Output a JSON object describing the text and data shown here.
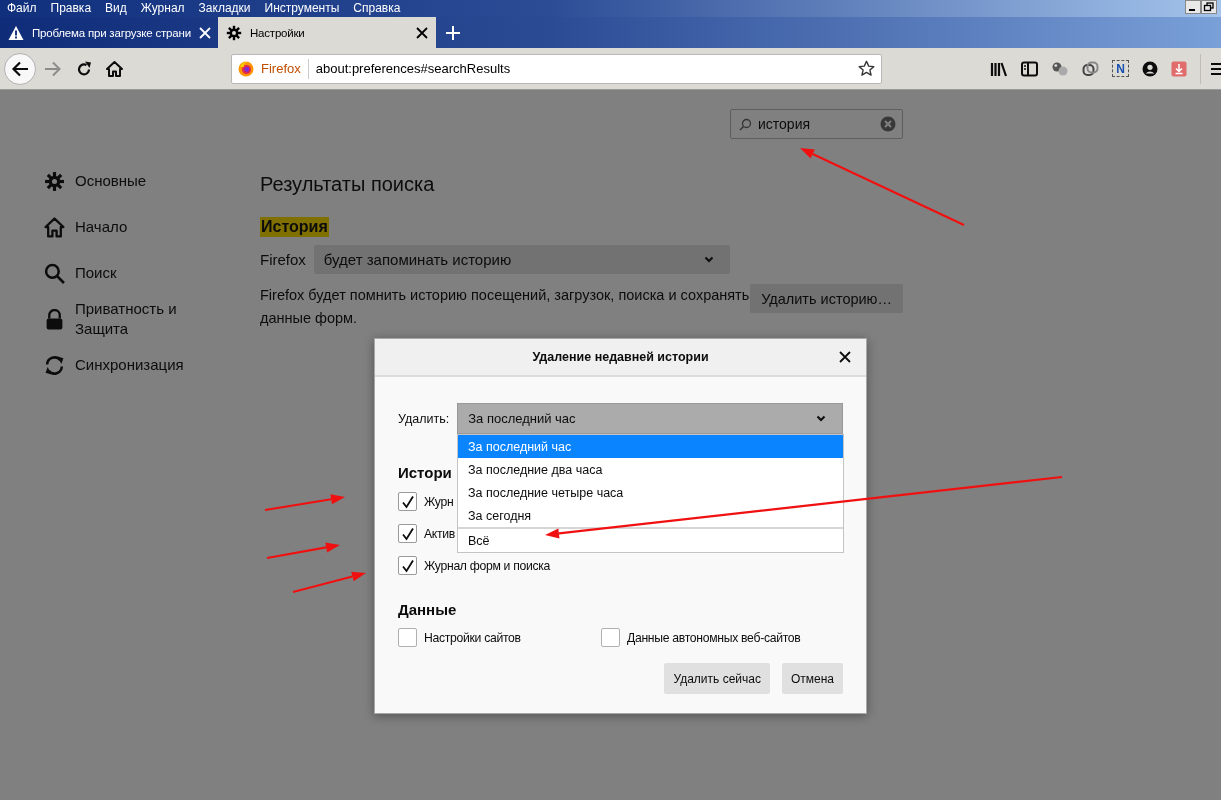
{
  "menu": [
    {
      "label": "Файл"
    },
    {
      "label": "Правка"
    },
    {
      "label": "Вид"
    },
    {
      "label": "Журнал"
    },
    {
      "label": "Закладки"
    },
    {
      "label": "Инструменты"
    },
    {
      "label": "Справка"
    }
  ],
  "tabs": [
    {
      "label": "Проблема при загрузке страни",
      "kind": "warning",
      "selected": false
    },
    {
      "label": "Настройки",
      "kind": "settings",
      "selected": true
    }
  ],
  "toolbar": {
    "buttons": [
      {
        "kind": "back",
        "disabled": false
      },
      {
        "kind": "forward",
        "disabled": true
      },
      {
        "kind": "reload",
        "disabled": false
      },
      {
        "kind": "home",
        "disabled": false
      }
    ],
    "address": {
      "identity": "Firefox",
      "url": "about:preferences#searchResults"
    },
    "extensions": [
      {
        "kind": "library"
      },
      {
        "kind": "sidebar"
      },
      {
        "kind": "spheres"
      },
      {
        "kind": "loop"
      },
      {
        "kind": "note",
        "label": "N"
      },
      {
        "kind": "account"
      },
      {
        "kind": "download"
      },
      {
        "kind": "menu"
      }
    ]
  },
  "sidebar": {
    "items": [
      {
        "label": "Основные",
        "kind": "general",
        "selected": false
      },
      {
        "label": "Начало",
        "kind": "home",
        "selected": false
      },
      {
        "label": "Поиск",
        "kind": "search",
        "selected": false
      },
      {
        "label": "Приватность и Защита",
        "kind": "privacy",
        "selected": false
      },
      {
        "label": "Синхронизация",
        "kind": "sync",
        "selected": false
      }
    ]
  },
  "search": {
    "value": "история"
  },
  "results": {
    "title": "Результаты поиска",
    "section": {
      "label": "История",
      "highlighted": true
    },
    "mode_label": "Firefox",
    "mode_value": "будет запоминать историю",
    "description": "Firefox будет помнить историю посещений, загрузок, поиска и сохранять данные форм.",
    "clear_button": "Удалить историю…"
  },
  "dialog": {
    "title": "Удаление недавней истории",
    "range_label": "Удалить:",
    "range_value": "За последний час",
    "options": [
      {
        "label": "За последний час",
        "selected": true,
        "separated": false
      },
      {
        "label": "За последние два часа",
        "selected": false,
        "separated": false
      },
      {
        "label": "За последние четыре часа",
        "selected": false,
        "separated": false
      },
      {
        "label": "За сегодня",
        "selected": false,
        "separated": false
      },
      {
        "label": "Всё",
        "selected": false,
        "separated": true
      }
    ],
    "history_heading": "Истори",
    "history_items": [
      {
        "label": "Журн",
        "checked": true
      },
      {
        "label": "Актив",
        "checked": true
      },
      {
        "label": "Журнал форм и поиска",
        "checked": true
      }
    ],
    "data_heading": "Данные",
    "data_items": [
      {
        "label": "Настройки сайтов",
        "checked": false
      },
      {
        "label": "Данные автономных веб-сайтов",
        "checked": false
      }
    ],
    "buttons": [
      {
        "label": "Удалить сейчас"
      },
      {
        "label": "Отмена"
      }
    ]
  }
}
